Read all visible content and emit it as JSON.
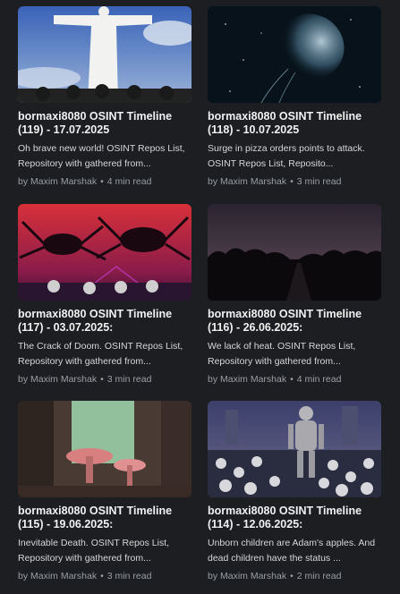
{
  "posts": [
    {
      "title": "bormaxi8080 OSINT Timeline\n(119) - 17.07.2025",
      "excerpt": "Oh brave new world! OSINT Repos List, Repository with gathered from...",
      "author": "by Maxim Marshak",
      "separator": "•",
      "read_time": "4 min read",
      "image": "christ-statue-with-soldiers-image"
    },
    {
      "title": "bormaxi8080 OSINT Timeline\n(118) - 10.07.2025",
      "excerpt": "Surge in pizza orders points to attack. OSINT Repos List, Reposito...",
      "author": "by Maxim Marshak",
      "separator": "•",
      "read_time": "3 min read",
      "image": "jellyfish-in-space-image"
    },
    {
      "title": "bormaxi8080 OSINT Timeline\n(117) - 03.07.2025:",
      "excerpt": "The Crack of Doom. OSINT Repos List, Repository with gathered from...",
      "author": "by Maxim Marshak",
      "separator": "•",
      "read_time": "3 min read",
      "image": "red-spiders-and-figures-image"
    },
    {
      "title": "bormaxi8080 OSINT Timeline\n(116) - 26.06.2025:",
      "excerpt": "We lack of heat. OSINT Repos List, Repository with gathered from...",
      "author": "by Maxim Marshak",
      "separator": "•",
      "read_time": "4 min read",
      "image": "dark-forest-road-image"
    },
    {
      "title": "bormaxi8080 OSINT Timeline\n(115) - 19.06.2025:",
      "excerpt": "Inevitable Death. OSINT Repos List, Repository with gathered from...",
      "author": "by Maxim Marshak",
      "separator": "•",
      "read_time": "3 min read",
      "image": "green-mushroom-city-image"
    },
    {
      "title": "bormaxi8080 OSINT Timeline\n(114) - 12.06.2025:",
      "excerpt": "Unborn children are Adam's apples. And dead children have the status ...",
      "author": "by Maxim Marshak",
      "separator": "•",
      "read_time": "2 min read",
      "image": "robot-on-skulls-image"
    }
  ]
}
